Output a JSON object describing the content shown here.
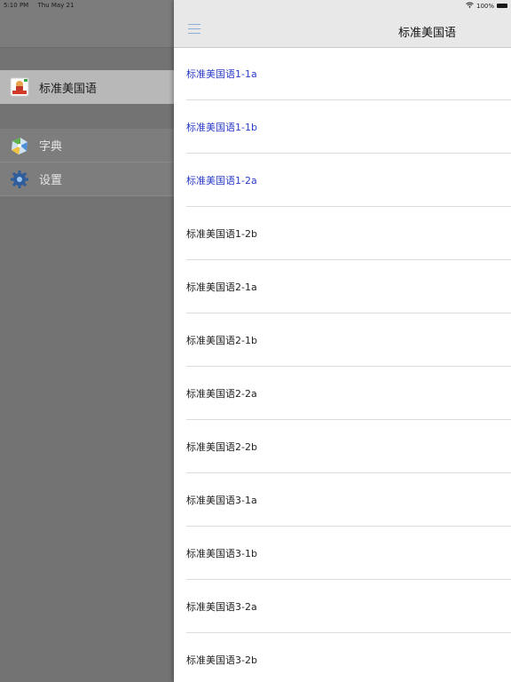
{
  "status": {
    "time": "5:10 PM",
    "date": "Thu May 21",
    "battery": "100%"
  },
  "sidebar": {
    "items": [
      {
        "label": "标准美国语",
        "icon": "app-book-icon"
      },
      {
        "label": "字典",
        "icon": "dictionary-icon"
      },
      {
        "label": "设置",
        "icon": "gear-icon"
      }
    ]
  },
  "navbar": {
    "title": "标准美国语",
    "menu_icon": "hamburger-menu-icon"
  },
  "list": {
    "items": [
      {
        "label": "标准美国语1-1a",
        "visited": true
      },
      {
        "label": "标准美国语1-1b",
        "visited": true
      },
      {
        "label": "标准美国语1-2a",
        "visited": true
      },
      {
        "label": "标准美国语1-2b",
        "visited": false
      },
      {
        "label": "标准美国语2-1a",
        "visited": false
      },
      {
        "label": "标准美国语2-1b",
        "visited": false
      },
      {
        "label": "标准美国语2-2a",
        "visited": false
      },
      {
        "label": "标准美国语2-2b",
        "visited": false
      },
      {
        "label": "标准美国语3-1a",
        "visited": false
      },
      {
        "label": "标准美国语3-1b",
        "visited": false
      },
      {
        "label": "标准美国语3-2a",
        "visited": false
      },
      {
        "label": "标准美国语3-2b",
        "visited": false
      }
    ]
  },
  "colors": {
    "visited_link": "#2b3cc9",
    "text": "#222222",
    "sidebar_active": "#b8b8b8"
  }
}
